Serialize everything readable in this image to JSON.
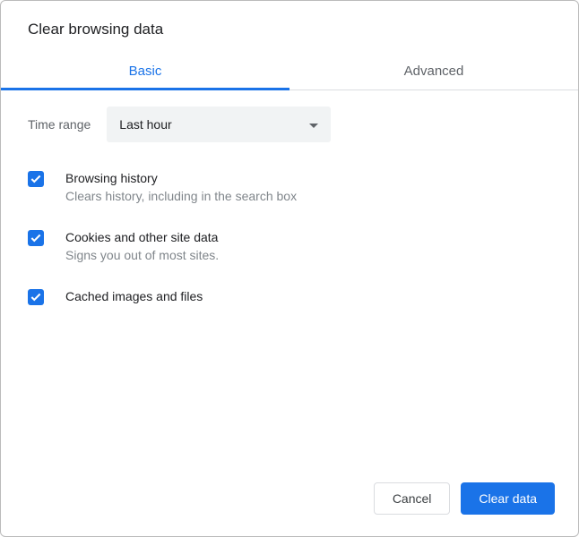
{
  "title": "Clear browsing data",
  "tabs": {
    "basic": "Basic",
    "advanced": "Advanced"
  },
  "timeRange": {
    "label": "Time range",
    "value": "Last hour"
  },
  "options": [
    {
      "title": "Browsing history",
      "sub": "Clears history, including in the search box",
      "checked": true
    },
    {
      "title": "Cookies and other site data",
      "sub": "Signs you out of most sites.",
      "checked": true
    },
    {
      "title": "Cached images and files",
      "sub": "",
      "checked": true
    }
  ],
  "buttons": {
    "cancel": "Cancel",
    "clear": "Clear data"
  }
}
